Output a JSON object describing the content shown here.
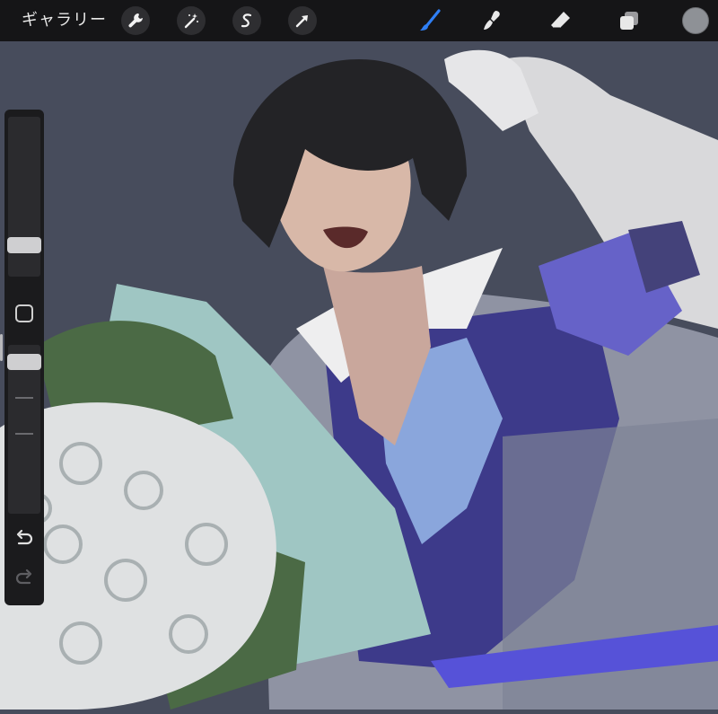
{
  "toolbar": {
    "gallery_label": "ギャラリー",
    "left_tools": [
      "wrench-icon",
      "magic-wand-icon",
      "selection-s-icon",
      "transform-arrow-icon"
    ],
    "right_tools": [
      "brush-icon",
      "smudge-icon",
      "eraser-icon",
      "layers-icon"
    ],
    "active_tool": "brush",
    "active_color": "#8e9196",
    "accent_color": "#2f7ff5"
  },
  "sidebar": {
    "brush_size_level": 0.19,
    "opacity_level": 0.76,
    "buttons": [
      "modify-square-icon",
      "undo-icon",
      "redo-icon"
    ]
  },
  "canvas": {
    "background_color": "#474c5c",
    "subject": "illustration"
  }
}
